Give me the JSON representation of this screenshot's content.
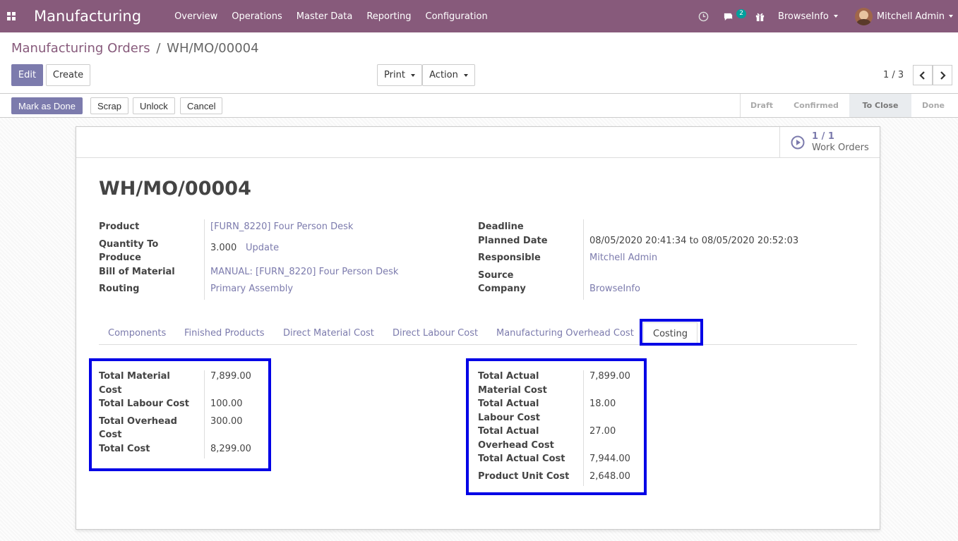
{
  "navbar": {
    "brand": "Manufacturing",
    "menu": [
      "Overview",
      "Operations",
      "Master Data",
      "Reporting",
      "Configuration"
    ],
    "messages_count": "2",
    "company": "BrowseInfo",
    "user": "Mitchell Admin",
    "icons": [
      "apps-icon",
      "clock-icon",
      "chat-icon",
      "gift-icon"
    ]
  },
  "breadcrumb": {
    "parent": "Manufacturing Orders",
    "separator": "/",
    "current": "WH/MO/00004"
  },
  "toolbar": {
    "edit": "Edit",
    "create": "Create",
    "print": "Print",
    "action": "Action",
    "pager": "1 / 3"
  },
  "statusbar": {
    "buttons": [
      "Mark as Done",
      "Scrap",
      "Unlock",
      "Cancel"
    ],
    "stages": [
      "Draft",
      "Confirmed",
      "To Close",
      "Done"
    ],
    "active_stage": "To Close"
  },
  "smart_button": {
    "value": "1 / 1",
    "label": "Work Orders"
  },
  "record": {
    "title": "WH/MO/00004",
    "left_fields": {
      "product_label": "Product",
      "product_value": "[FURN_8220] Four Person Desk",
      "qty_label_1": "Quantity To",
      "qty_label_2": "Produce",
      "qty_value": "3.000",
      "qty_update": "Update",
      "bom_label": "Bill of Material",
      "bom_value": "MANUAL: [FURN_8220] Four Person Desk",
      "routing_label": "Routing",
      "routing_value": "Primary Assembly"
    },
    "right_fields": {
      "deadline_label": "Deadline",
      "planned_label": "Planned Date",
      "planned_value": "08/05/2020 20:41:34 to 08/05/2020 20:52:03",
      "responsible_label": "Responsible",
      "responsible_value": "Mitchell Admin",
      "source_label": "Source",
      "company_label": "Company",
      "company_value": "BrowseInfo"
    }
  },
  "tabs": [
    "Components",
    "Finished Products",
    "Direct Material Cost",
    "Direct Labour Cost",
    "Manufacturing Overhead Cost",
    "Costing"
  ],
  "active_tab": "Costing",
  "costing": {
    "planned": [
      {
        "label_1": "Total Material",
        "label_2": "Cost",
        "value": "7,899.00"
      },
      {
        "label_1": "Total Labour Cost",
        "label_2": "",
        "value": "100.00"
      },
      {
        "label_1": "Total Overhead",
        "label_2": "Cost",
        "value": "300.00"
      },
      {
        "label_1": "Total Cost",
        "label_2": "",
        "value": "8,299.00"
      }
    ],
    "actual": [
      {
        "label_1": "Total Actual",
        "label_2": "Material Cost",
        "value": "7,899.00"
      },
      {
        "label_1": "Total Actual",
        "label_2": "Labour Cost",
        "value": "18.00"
      },
      {
        "label_1": "Total Actual",
        "label_2": "Overhead Cost",
        "value": "27.00"
      },
      {
        "label_1": "Total Actual Cost",
        "label_2": "",
        "value": "7,944.00"
      },
      {
        "label_1": "Product Unit Cost",
        "label_2": "",
        "value": "2,648.00"
      }
    ]
  },
  "colors": {
    "navbar": "#875a7b",
    "primary": "#7c7bad",
    "highlight": "#0000e6"
  }
}
